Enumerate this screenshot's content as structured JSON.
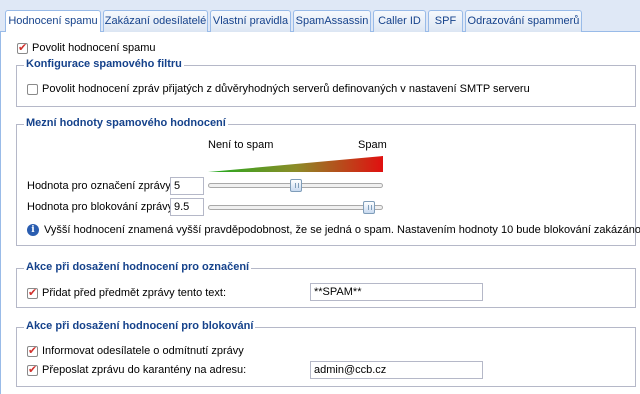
{
  "tabs": [
    {
      "label": "Hodnocení spamu",
      "active": true
    },
    {
      "label": "Zakázaní odesílatelé"
    },
    {
      "label": "Vlastní pravidla"
    },
    {
      "label": "SpamAssassin"
    },
    {
      "label": "Caller ID"
    },
    {
      "label": "SPF"
    },
    {
      "label": "Odrazování spammerů"
    }
  ],
  "enable_spam": {
    "label": "Povolit hodnocení spamu",
    "checked": true
  },
  "filter_config": {
    "legend": "Konfigurace spamového filtru",
    "trusted_label": "Povolit hodnocení zpráv přijatých z důvěryhodných serverů definovaných v nastavení SMTP serveru",
    "trusted_checked": false
  },
  "thresholds": {
    "legend": "Mezní hodnoty spamového hodnocení",
    "scale_left": "Není to spam",
    "scale_right": "Spam",
    "mark_label": "Hodnota pro označení zprávy:",
    "mark_value": "5",
    "mark_fraction": 0.5,
    "block_label": "Hodnota pro blokování zprávy:",
    "block_value": "9.5",
    "block_fraction": 0.95,
    "info_text": "Vyšší hodnocení znamená vyšší pravděpodobnost, že se jedná o spam. Nastavením hodnoty 10 bude blokování zakázáno."
  },
  "mark_action": {
    "legend": "Akce při dosažení hodnocení pro označení",
    "prefix_label": "Přidat před předmět zprávy tento text:",
    "prefix_checked": true,
    "prefix_value": "**SPAM**"
  },
  "block_action": {
    "legend": "Akce při dosažení hodnocení pro blokování",
    "notify_label": "Informovat odesílatele o odmítnutí zprávy",
    "notify_checked": true,
    "forward_label": "Přeposlat zprávu do karantény na adresu:",
    "forward_checked": true,
    "forward_value": "admin@ccb.cz"
  },
  "colors": {
    "gradient_start": "#1faa1f",
    "gradient_end": "#e01010",
    "tab_text": "#15428b"
  }
}
